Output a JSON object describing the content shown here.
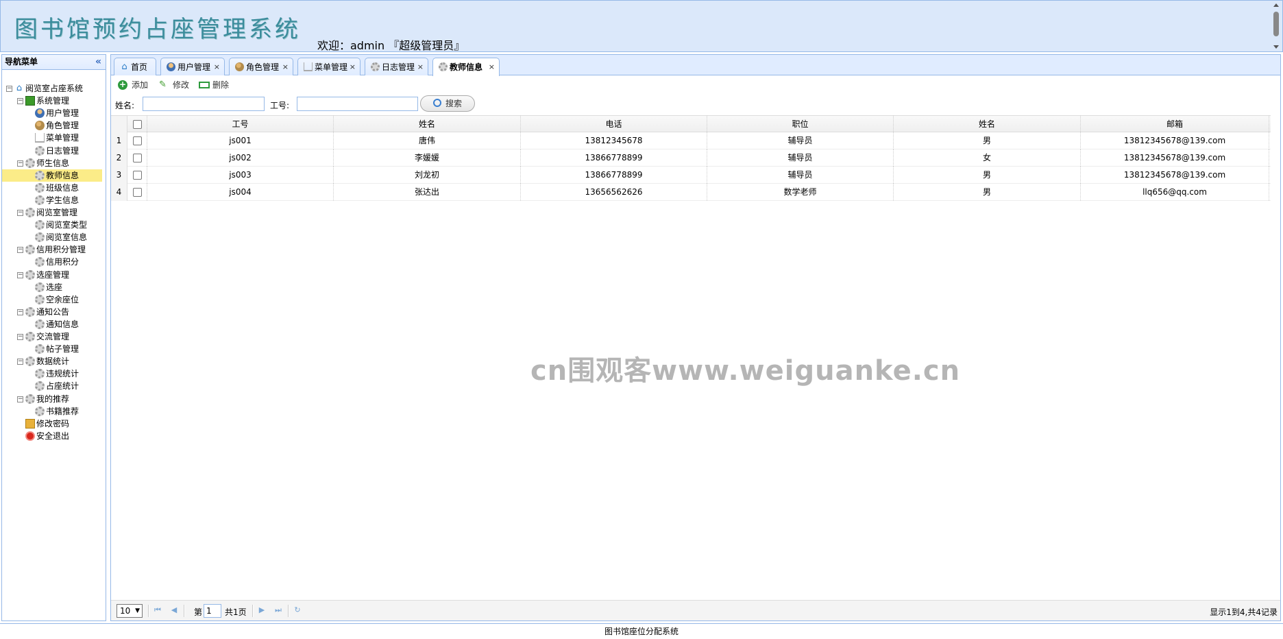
{
  "header": {
    "title": "图书馆预约占座管理系统",
    "welcome": "欢迎：admin 『超级管理员』"
  },
  "sidebar": {
    "title": "导航菜单",
    "tree": [
      {
        "label": "阅览室占座系统",
        "icon": "home-icon"
      },
      {
        "label": "系统管理",
        "icon": "system-icon"
      },
      {
        "label": "用户管理",
        "icon": "user-icon"
      },
      {
        "label": "角色管理",
        "icon": "role-icon"
      },
      {
        "label": "菜单管理",
        "icon": "menu-icon"
      },
      {
        "label": "日志管理",
        "icon": "gear-icon"
      },
      {
        "label": "师生信息",
        "icon": "gear-icon"
      },
      {
        "label": "教师信息",
        "icon": "gear-icon"
      },
      {
        "label": "班级信息",
        "icon": "gear-icon"
      },
      {
        "label": "学生信息",
        "icon": "gear-icon"
      },
      {
        "label": "阅览室管理",
        "icon": "gear-icon"
      },
      {
        "label": "阅览室类型",
        "icon": "gear-icon"
      },
      {
        "label": "阅览室信息",
        "icon": "gear-icon"
      },
      {
        "label": "信用积分管理",
        "icon": "gear-icon"
      },
      {
        "label": "信用积分",
        "icon": "gear-icon"
      },
      {
        "label": "选座管理",
        "icon": "gear-icon"
      },
      {
        "label": "选座",
        "icon": "gear-icon"
      },
      {
        "label": "空余座位",
        "icon": "gear-icon"
      },
      {
        "label": "通知公告",
        "icon": "gear-icon"
      },
      {
        "label": "通知信息",
        "icon": "gear-icon"
      },
      {
        "label": "交流管理",
        "icon": "gear-icon"
      },
      {
        "label": "帖子管理",
        "icon": "gear-icon"
      },
      {
        "label": "数据统计",
        "icon": "gear-icon"
      },
      {
        "label": "违规统计",
        "icon": "gear-icon"
      },
      {
        "label": "占座统计",
        "icon": "gear-icon"
      },
      {
        "label": "我的推荐",
        "icon": "gear-icon"
      },
      {
        "label": "书籍推荐",
        "icon": "gear-icon"
      },
      {
        "label": "修改密码",
        "icon": "key-icon"
      },
      {
        "label": "安全退出",
        "icon": "exit-icon"
      }
    ],
    "selected": "教师信息"
  },
  "tabs": [
    {
      "label": "首页",
      "closable": false
    },
    {
      "label": "用户管理",
      "closable": true
    },
    {
      "label": "角色管理",
      "closable": true
    },
    {
      "label": "菜单管理",
      "closable": true
    },
    {
      "label": "日志管理",
      "closable": true
    },
    {
      "label": "教师信息",
      "closable": true,
      "active": true
    }
  ],
  "toolbar": {
    "add_label": "添加",
    "edit_label": "修改",
    "delete_label": "删除"
  },
  "search": {
    "name_label": "姓名:",
    "id_label": "工号:",
    "name_value": "",
    "id_value": "",
    "button_label": "搜索"
  },
  "grid": {
    "columns": [
      "工号",
      "姓名",
      "电话",
      "职位",
      "姓名",
      "邮箱"
    ],
    "rows": [
      {
        "num": "1",
        "cells": [
          "js001",
          "唐伟",
          "13812345678",
          "辅导员",
          "男",
          "13812345678@139.com"
        ]
      },
      {
        "num": "2",
        "cells": [
          "js002",
          "李媛媛",
          "13866778899",
          "辅导员",
          "女",
          "13812345678@139.com"
        ]
      },
      {
        "num": "3",
        "cells": [
          "js003",
          "刘龙初",
          "13866778899",
          "辅导员",
          "男",
          "13812345678@139.com"
        ]
      },
      {
        "num": "4",
        "cells": [
          "js004",
          "张达出",
          "13656562626",
          "数学老师",
          "男",
          "llq656@qq.com"
        ]
      }
    ]
  },
  "watermark": "cn围观客www.weiguanke.cn",
  "pager": {
    "page_size": "10",
    "page_prefix": "第",
    "page_value": "1",
    "page_total": "共1页",
    "info": "显示1到4,共4记录"
  },
  "footer": {
    "text": "图书馆座位分配系统"
  },
  "colors": {
    "border": "#95b8e7",
    "header_bg": "#dbe8fa",
    "tab_bar_bg": "#e0ecff",
    "selected_row": "#fbec88",
    "title_color": "#3b8c9c"
  }
}
